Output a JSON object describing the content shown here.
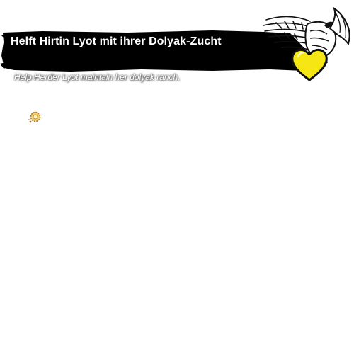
{
  "heart_panel": {
    "title": "Helft Hirtin Lyot mit ihrer Dolyak-Zucht",
    "subtitle": "Help Herder Lyot maintain her dolyak ranch.",
    "icons": {
      "emblem": "griffon-emblem-icon",
      "heart": "renown-heart-icon",
      "task": "ranch-task-icon"
    },
    "colors": {
      "banner": "#000000",
      "title_text": "#ffffff",
      "heart_fill": "#f5e614",
      "heart_outline": "#111111"
    }
  }
}
